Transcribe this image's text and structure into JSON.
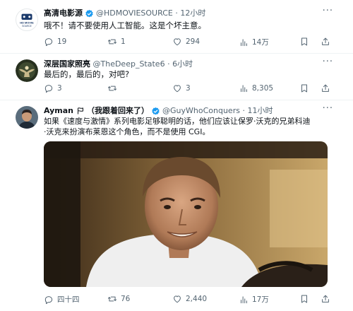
{
  "tweets": [
    {
      "display_name": "高清电影源",
      "handle": "@HDMOVIESOURCE",
      "time": "12小时",
      "text": "哦不！请不要使用人工智能。这是个坏主意。",
      "avatar_text": [
        "HD MOVIE",
        "SOURCE"
      ],
      "stats": {
        "replies": "19",
        "reposts": "1",
        "likes": "294",
        "views": "14万"
      }
    },
    {
      "display_name": "深层国家照亮",
      "handle": "@TheDeep_State6",
      "time": "6小时",
      "text": "最后的，最后的，对吧?",
      "stats": {
        "replies": "3",
        "reposts": "",
        "likes": "3",
        "views": "8,305"
      }
    },
    {
      "display_name": "Ayman",
      "name_suffix": "（我跟着回来了）",
      "handle": "@GuyWhoConquers",
      "time": "11小时",
      "text_lines": [
        "如果《速度与激情》系列电影足够聪明的话，他们应该让保罗·沃克的兄弟科迪",
        "·沃克来扮演布莱恩这个角色，而不是使用 CGI。"
      ],
      "stats": {
        "replies": "四十四",
        "reposts": "76",
        "likes": "2,440",
        "views": "17万"
      }
    }
  ],
  "separator": "·",
  "more_glyph": "···",
  "colors": {
    "verified": "#1d9bf0",
    "text": "#0f1419",
    "muted": "#536471",
    "divider": "#eff3f4"
  },
  "icons": [
    "reply-icon",
    "repost-icon",
    "like-icon",
    "views-icon",
    "bookmark-icon",
    "share-icon",
    "verified-badge-icon",
    "more-icon"
  ]
}
